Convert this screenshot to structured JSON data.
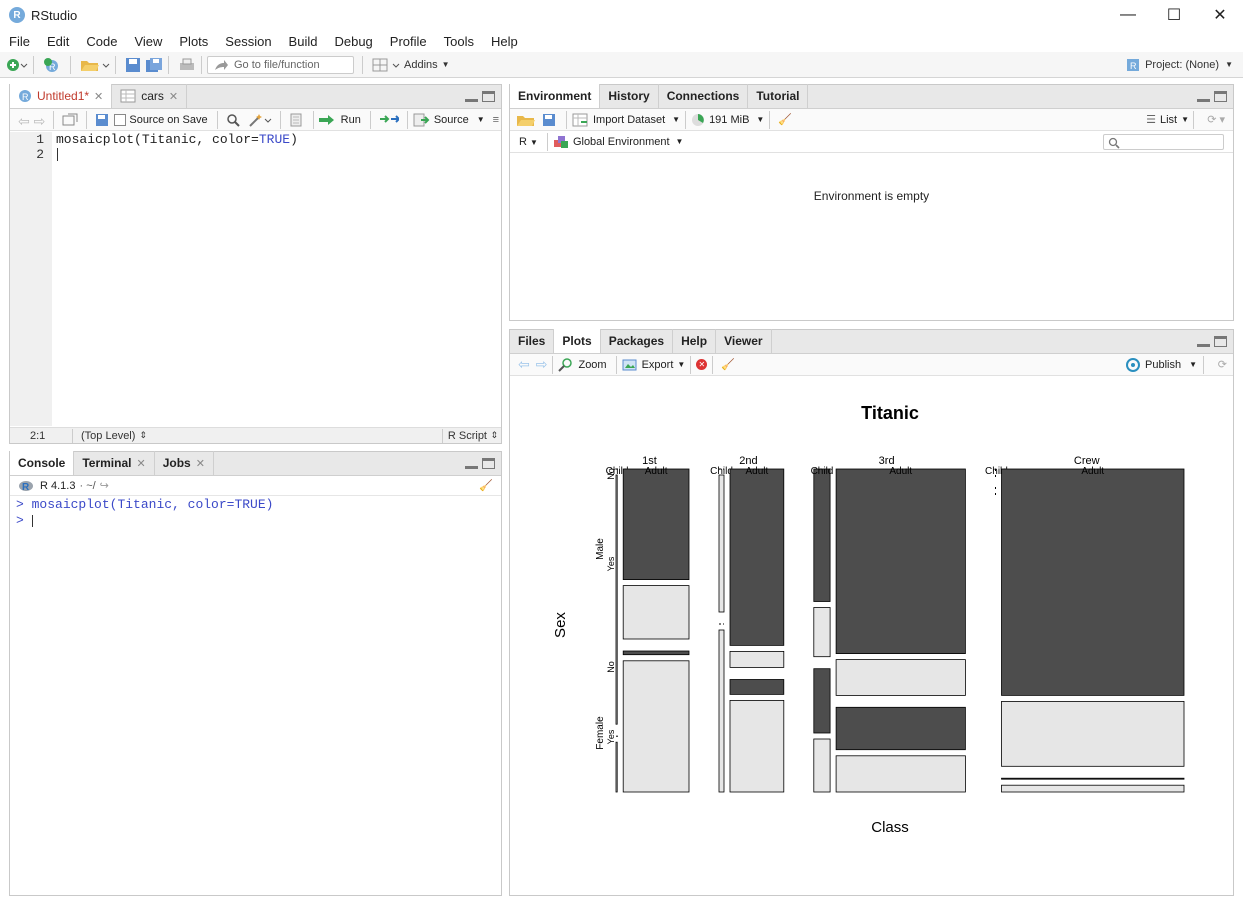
{
  "app": {
    "title": "RStudio",
    "icon_letter": "R"
  },
  "window_controls": {
    "minimize": "—",
    "maximize": "☐",
    "close": "✕"
  },
  "menu": [
    "File",
    "Edit",
    "Code",
    "View",
    "Plots",
    "Session",
    "Build",
    "Debug",
    "Profile",
    "Tools",
    "Help"
  ],
  "toolbar": {
    "goto_placeholder": "Go to file/function",
    "addins": "Addins",
    "project": "Project: (None)"
  },
  "editor": {
    "tabs": [
      {
        "label": "Untitled1*",
        "active": true
      },
      {
        "label": "cars",
        "active": false
      }
    ],
    "source_on_save": "Source on Save",
    "run": "Run",
    "source": "Source",
    "lines": [
      {
        "num": "1",
        "code_fn": "mosaicplot(Titanic, color=",
        "code_kw": "TRUE",
        "code_end": ")"
      },
      {
        "num": "2"
      }
    ],
    "status": {
      "position": "2:1",
      "scope": "(Top Level)",
      "type": "R Script"
    }
  },
  "console": {
    "tabs": [
      "Console",
      "Terminal",
      "Jobs"
    ],
    "version": "R 4.1.3",
    "path": "· ~/",
    "prompt": ">",
    "command": "mosaicplot(Titanic, color=TRUE)"
  },
  "environment": {
    "tabs": [
      "Environment",
      "History",
      "Connections",
      "Tutorial"
    ],
    "import_dataset": "Import Dataset",
    "memory": "191 MiB",
    "list_view": "List",
    "lang": "R",
    "scope": "Global Environment",
    "empty_message": "Environment is empty"
  },
  "files": {
    "tabs": [
      "Files",
      "Plots",
      "Packages",
      "Help",
      "Viewer"
    ],
    "zoom": "Zoom",
    "export": "Export",
    "publish": "Publish"
  },
  "chart_data": {
    "type": "mosaic",
    "title": "Titanic",
    "xlabel": "Class",
    "ylabel": "Sex",
    "class_labels": [
      "1st",
      "2nd",
      "3rd",
      "Crew"
    ],
    "age_labels": [
      "Child",
      "Adult"
    ],
    "sex_labels": [
      "Male",
      "Female"
    ],
    "survived_labels": [
      "No",
      "Yes"
    ],
    "colors": {
      "no": "#4d4d4d",
      "yes": "#e6e6e6"
    },
    "counts": {
      "1st": {
        "Child": {
          "Male": [
            0,
            5
          ],
          "Female": [
            0,
            1
          ]
        },
        "Adult": {
          "Male": [
            118,
            57
          ],
          "Female": [
            4,
            140
          ]
        }
      },
      "2nd": {
        "Child": {
          "Male": [
            0,
            11
          ],
          "Female": [
            0,
            13
          ]
        },
        "Adult": {
          "Male": [
            154,
            14
          ],
          "Female": [
            13,
            80
          ]
        }
      },
      "3rd": {
        "Child": {
          "Male": [
            35,
            13
          ],
          "Female": [
            17,
            14
          ]
        },
        "Adult": {
          "Male": [
            387,
            75
          ],
          "Female": [
            89,
            76
          ]
        }
      },
      "Crew": {
        "Child": {
          "Male": [
            0,
            0
          ],
          "Female": [
            0,
            0
          ]
        },
        "Adult": {
          "Male": [
            670,
            192
          ],
          "Female": [
            3,
            20
          ]
        }
      }
    }
  }
}
